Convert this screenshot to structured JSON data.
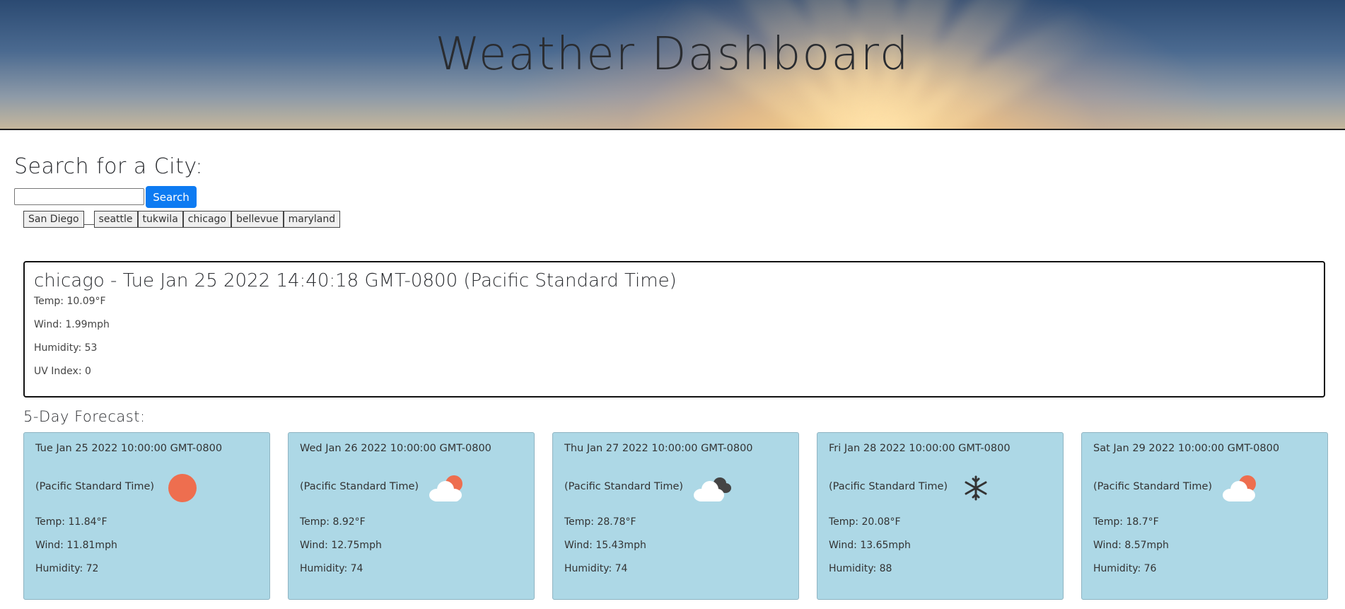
{
  "header": {
    "title": "Weather Dashboard"
  },
  "search": {
    "heading": "Search for a City:",
    "input_value": "",
    "button_label": "Search",
    "history": [
      "San Diego",
      "seattle",
      "tukwila",
      "chicago",
      "bellevue",
      "maryland"
    ]
  },
  "current": {
    "title": "chicago - Tue Jan 25 2022 14:40:18 GMT-0800 (Pacific Standard Time)",
    "temp": "Temp: 10.09°F",
    "wind": "Wind: 1.99mph",
    "humidity": "Humidity: 53",
    "uv": "UV Index: 0"
  },
  "forecast": {
    "heading": "5-Day Forecast:",
    "days": [
      {
        "date": "Tue Jan 25 2022 10:00:00 GMT-0800",
        "tz": "(Pacific Standard Time)",
        "icon": "sun-icon",
        "temp": "Temp: 11.84°F",
        "wind": "Wind: 11.81mph",
        "humidity": "Humidity: 72"
      },
      {
        "date": "Wed Jan 26 2022 10:00:00 GMT-0800",
        "tz": "(Pacific Standard Time)",
        "icon": "partly-cloudy-icon",
        "temp": "Temp: 8.92°F",
        "wind": "Wind: 12.75mph",
        "humidity": "Humidity: 74"
      },
      {
        "date": "Thu Jan 27 2022 10:00:00 GMT-0800",
        "tz": "(Pacific Standard Time)",
        "icon": "cloudy-icon",
        "temp": "Temp: 28.78°F",
        "wind": "Wind: 15.43mph",
        "humidity": "Humidity: 74"
      },
      {
        "date": "Fri Jan 28 2022 10:00:00 GMT-0800",
        "tz": "(Pacific Standard Time)",
        "icon": "snowflake-icon",
        "temp": "Temp: 20.08°F",
        "wind": "Wind: 13.65mph",
        "humidity": "Humidity: 88"
      },
      {
        "date": "Sat Jan 29 2022 10:00:00 GMT-0800",
        "tz": "(Pacific Standard Time)",
        "icon": "partly-cloudy-icon",
        "temp": "Temp: 18.7°F",
        "wind": "Wind: 8.57mph",
        "humidity": "Humidity: 76"
      }
    ]
  },
  "colors": {
    "accent": "#0d7bf2",
    "card_bg": "#add8e6",
    "sun": "#ee6e4f",
    "cloud": "#ffffff",
    "dark_cloud": "#444444"
  }
}
